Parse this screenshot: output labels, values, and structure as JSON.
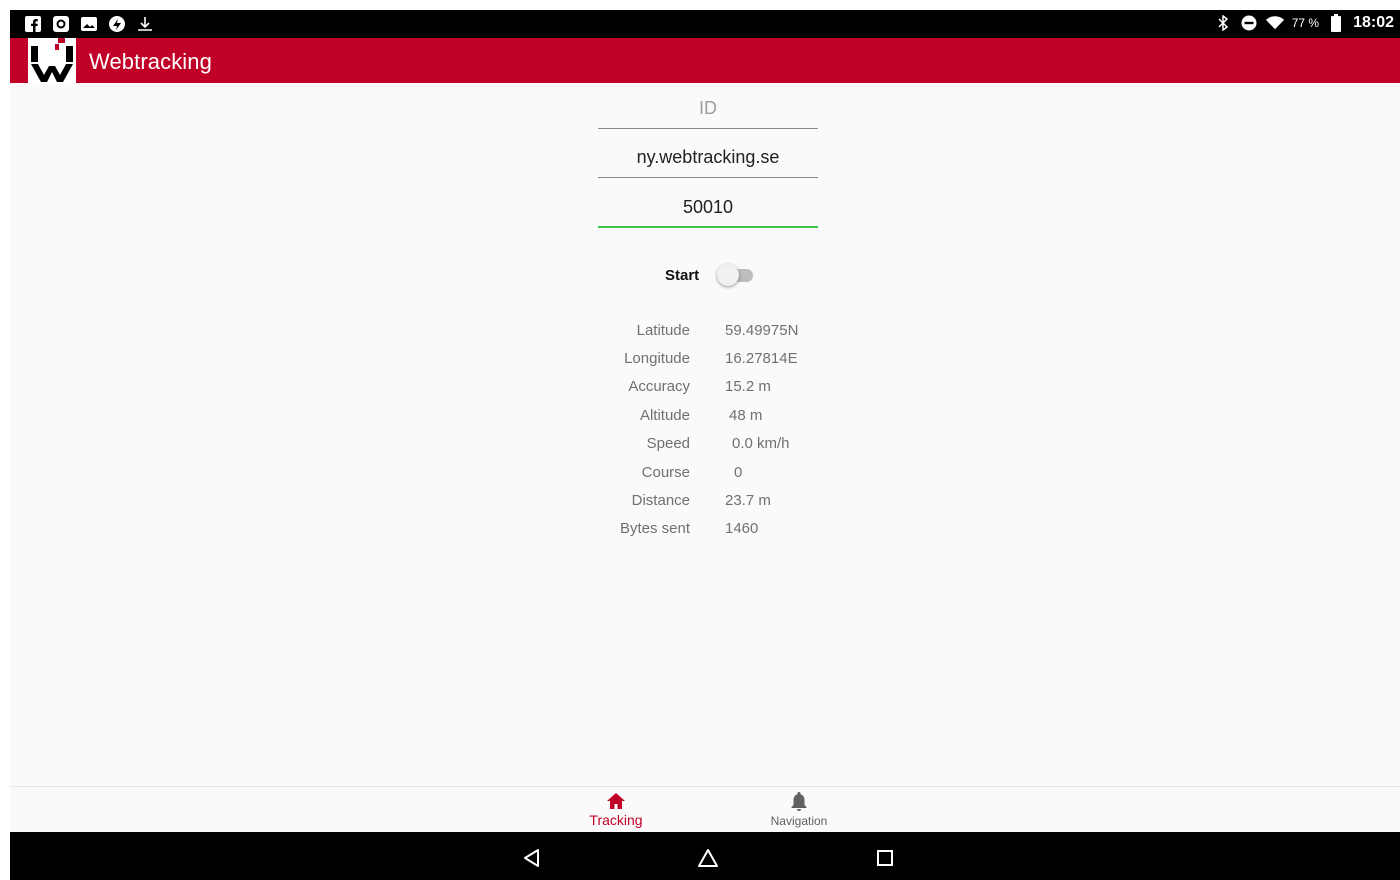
{
  "status_bar": {
    "left_icons": [
      "facebook-icon",
      "record-icon",
      "image-icon",
      "notification-icon",
      "download-icon"
    ],
    "battery_percent": "77 %",
    "time": "18:02"
  },
  "app_bar": {
    "title": "Webtracking"
  },
  "form": {
    "id_placeholder": "ID",
    "id_value": "",
    "host_value": "ny.webtracking.se",
    "port_value": "50010"
  },
  "start": {
    "label": "Start",
    "on": false
  },
  "info": [
    {
      "label": "Latitude",
      "value": "59.49975N"
    },
    {
      "label": "Longitude",
      "value": "16.27814E"
    },
    {
      "label": "Accuracy",
      "value": "15.2 m"
    },
    {
      "label": "Altitude",
      "value": "48 m"
    },
    {
      "label": "Speed",
      "value": "0.0 km/h"
    },
    {
      "label": "Course",
      "value": "0"
    },
    {
      "label": "Distance",
      "value": "23.7 m"
    },
    {
      "label": "Bytes sent",
      "value": "1460"
    }
  ],
  "bottom_nav": {
    "tracking_label": "Tracking",
    "navigation_label": "Navigation"
  },
  "colors": {
    "brand": "#c10028",
    "focus_line": "#3cc44a"
  }
}
